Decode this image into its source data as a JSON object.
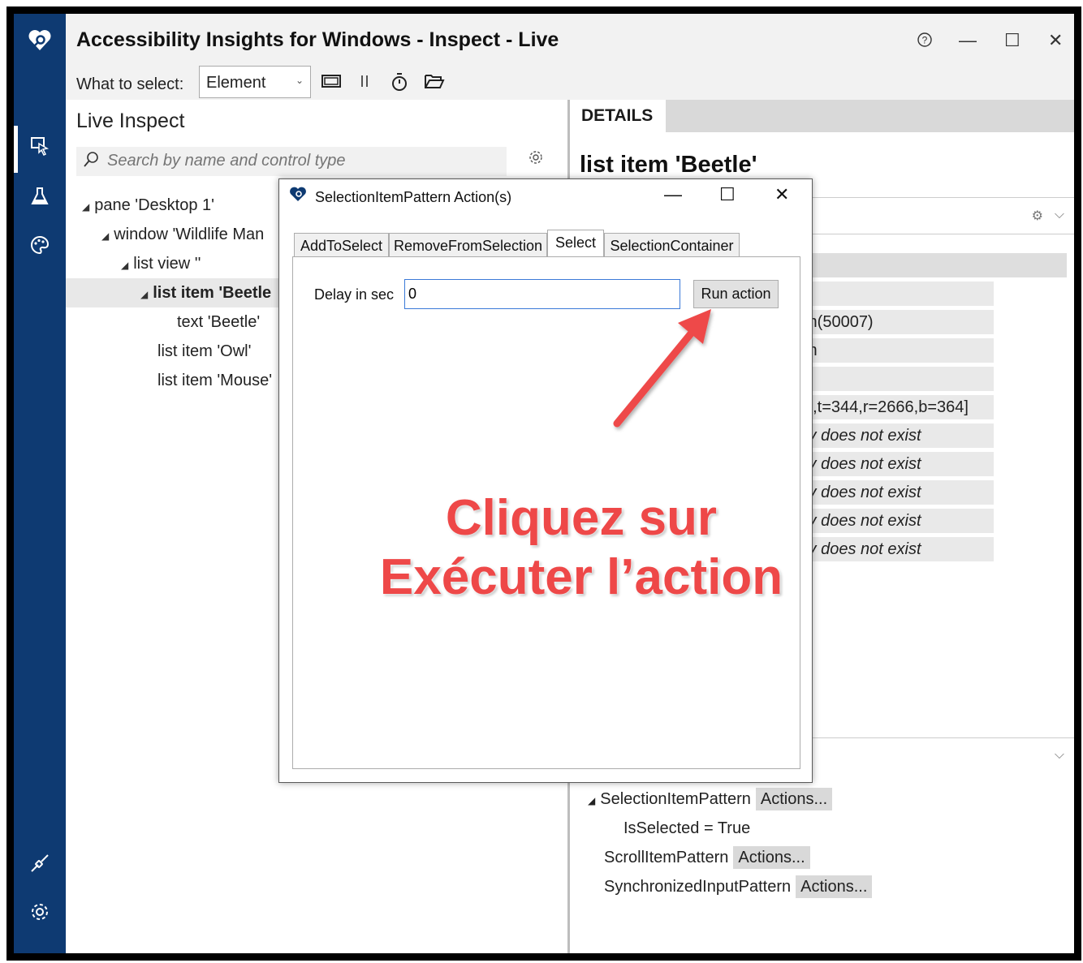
{
  "window": {
    "title": "Accessibility Insights for Windows - Inspect - Live",
    "controls": {
      "help": "?",
      "minimize": "—",
      "maximize": "☐",
      "close": "✕"
    }
  },
  "toolbar": {
    "what_to_select_label": "What to select:",
    "select_value": "Element",
    "icons": [
      "screen-icon",
      "pause-icon",
      "timer-icon",
      "open-folder-icon"
    ]
  },
  "nav": {
    "icons": [
      "app-logo-icon",
      "inspect-icon",
      "test-flask-icon",
      "color-contrast-icon",
      "connection-icon",
      "settings-gear-icon"
    ]
  },
  "left_pane": {
    "title": "Live Inspect",
    "search_placeholder": "Search by name and control type",
    "tree": [
      {
        "label": "pane 'Desktop 1'",
        "indent": 0,
        "expanded": true,
        "selected": false
      },
      {
        "label": "window 'Wildlife Man",
        "indent": 1,
        "expanded": true,
        "selected": false
      },
      {
        "label": "list view ''",
        "indent": 2,
        "expanded": true,
        "selected": false
      },
      {
        "label": "list item 'Beetle",
        "indent": 3,
        "expanded": true,
        "selected": true
      },
      {
        "label": "text 'Beetle'",
        "indent": 4,
        "expanded": false,
        "selected": false
      },
      {
        "label": "list item 'Owl'",
        "indent": 3,
        "expanded": false,
        "selected": false
      },
      {
        "label": "list item 'Mouse'",
        "indent": 3,
        "expanded": false,
        "selected": false
      }
    ]
  },
  "details": {
    "tab_label": "DETAILS",
    "title": "list item 'Beetle'",
    "property_values": [
      "",
      "",
      "m(50007)",
      "m",
      "",
      "6,t=344,r=2666,b=364]",
      "ty does not exist",
      "ty does not exist",
      "ty does not exist",
      "ty does not exist",
      "ty does not exist"
    ],
    "patterns": [
      {
        "name": "SelectionItemPattern",
        "action": "Actions...",
        "expanded": true
      },
      {
        "name": "IsSelected = True",
        "action": "",
        "child": true
      },
      {
        "name": "ScrollItemPattern",
        "action": "Actions..."
      },
      {
        "name": "SynchronizedInputPattern",
        "action": "Actions..."
      }
    ]
  },
  "dialog": {
    "title": "SelectionItemPattern Action(s)",
    "tabs": [
      "AddToSelect",
      "RemoveFromSelection",
      "Select",
      "SelectionContainer"
    ],
    "active_tab": "Select",
    "delay_label": "Delay in sec",
    "delay_value": "0",
    "run_button": "Run action"
  },
  "annotation": {
    "line1": "Cliquez sur",
    "line2": "Exécuter l’action",
    "color": "#ee4848"
  },
  "colors": {
    "nav_background": "#0e3a72",
    "selected_row": "#e8e8e8"
  }
}
